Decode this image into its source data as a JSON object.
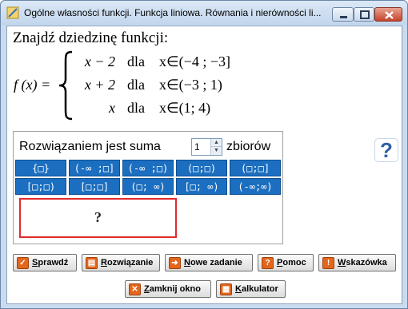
{
  "window": {
    "title": "Ogólne własności funkcji. Funkcja liniowa. Równania i nierówności li..."
  },
  "task": {
    "heading": "Znajdź dziedzinę funkcji:",
    "function_name": "f (x) =",
    "pieces": [
      {
        "expr": "x − 2",
        "word": "dla",
        "domain": "x∈(−4 ; −3]"
      },
      {
        "expr": "x + 2",
        "word": "dla",
        "domain": "x∈(−3 ; 1)"
      },
      {
        "expr": "x",
        "word": "dla",
        "domain": "x∈(1; 4)"
      }
    ]
  },
  "answer_panel": {
    "sum_label": "Rozwiązaniem jest suma",
    "spinner_value": "1",
    "sum_suffix": "zbiorów",
    "interval_buttons_row1": [
      "{□}",
      "(-∞ ;□]",
      "(-∞ ;□)",
      "(□;□)",
      "(□;□]"
    ],
    "interval_buttons_row2": [
      "[□;□)",
      "[□;□]",
      "(□; ∞)",
      "[□; ∞)",
      "(-∞;∞)"
    ],
    "answer_placeholder": "?"
  },
  "help_icon": "question-mark-icon",
  "action_buttons": {
    "check": {
      "label_u": "S",
      "label_rest": "prawdź",
      "icon": "checkmark-icon"
    },
    "solution": {
      "label_u": "R",
      "label_rest": "ozwiązanie",
      "icon": "document-icon"
    },
    "new_task": {
      "label_u": "N",
      "label_rest": "owe zadanie",
      "icon": "arrow-right-icon"
    },
    "help": {
      "label_u": "P",
      "label_rest": "omoc",
      "icon": "question-icon"
    },
    "hint": {
      "label_u": "W",
      "label_rest": "skazówka",
      "icon": "exclamation-icon"
    }
  },
  "footer_buttons": {
    "close": {
      "label_u": "Z",
      "label_rest": "amknij okno",
      "icon": "close-icon"
    },
    "calculator": {
      "label_u": "K",
      "label_rest": "alkulator",
      "icon": "calculator-icon"
    }
  },
  "colors": {
    "interval_button": "#1c6fc0",
    "answer_border": "#e02b2b",
    "button_icon": "#e2661c"
  }
}
